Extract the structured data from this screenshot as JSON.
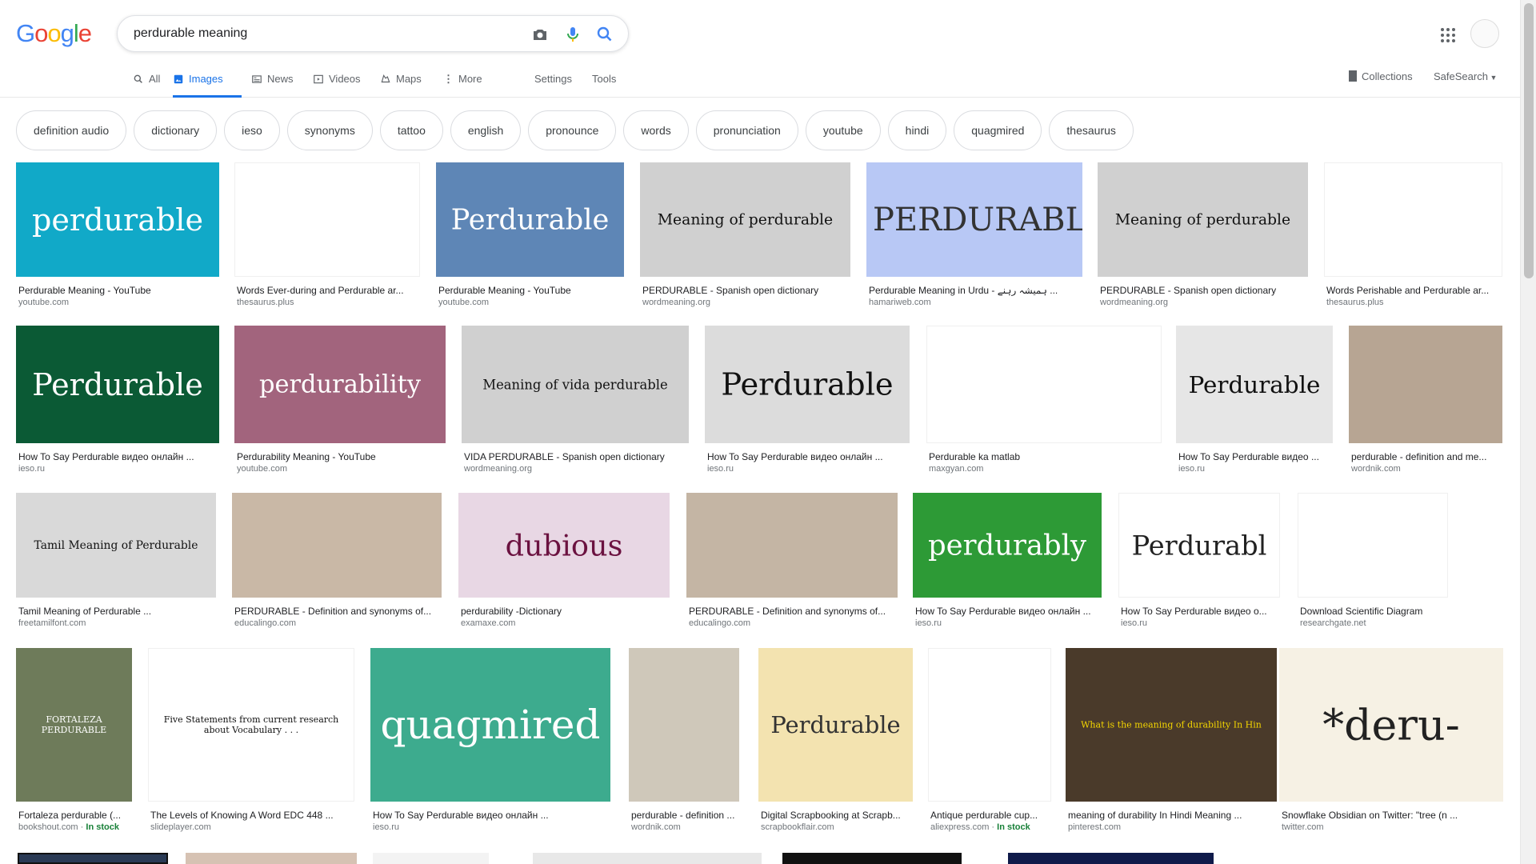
{
  "logo": {
    "letters": [
      "G",
      "o",
      "o",
      "g",
      "l",
      "e"
    ],
    "colors": [
      "#4285f4",
      "#ea4335",
      "#fbbc05",
      "#4285f4",
      "#34a853",
      "#ea4335"
    ]
  },
  "search": {
    "value": "perdurable meaning"
  },
  "tabs": {
    "all": "All",
    "images": "Images",
    "news": "News",
    "videos": "Videos",
    "maps": "Maps",
    "more": "More",
    "settings": "Settings",
    "tools": "Tools"
  },
  "right_nav": {
    "collections": "Collections",
    "safesearch": "SafeSearch"
  },
  "chips": [
    "definition audio",
    "dictionary",
    "ieso",
    "synonyms",
    "tattoo",
    "english",
    "pronounce",
    "words",
    "pronunciation",
    "youtube",
    "hindi",
    "quagmired",
    "thesaurus"
  ],
  "results": [
    {
      "caption": "Perdurable Meaning - YouTube",
      "source": "youtube.com",
      "img_text": "perdurable",
      "bg": "#11a9c8",
      "fg": "#ffffff"
    },
    {
      "caption": "Words Ever-during and Perdurable ar...",
      "source": "thesaurus.plus",
      "img_text": "",
      "bg": "#ffffff",
      "fg": "#333333"
    },
    {
      "caption": "Perdurable Meaning - YouTube",
      "source": "youtube.com",
      "img_text": "Perdurable",
      "bg": "#5e86b6",
      "fg": "#ffffff"
    },
    {
      "caption": "PERDURABLE - Spanish open dictionary",
      "source": "wordmeaning.org",
      "img_text": "Meaning of perdurable",
      "bg": "#d0d0d0",
      "fg": "#111111"
    },
    {
      "caption": "Perdurable Meaning in Urdu - ہمیشہ رہنے ...",
      "source": "hamariweb.com",
      "img_text": "PERDURABLE",
      "bg": "#b8c8f5",
      "fg": "#333333"
    },
    {
      "caption": "PERDURABLE - Spanish open dictionary",
      "source": "wordmeaning.org",
      "img_text": "Meaning of perdurable",
      "bg": "#d0d0d0",
      "fg": "#111111"
    },
    {
      "caption": "Words Perishable and Perdurable ar...",
      "source": "thesaurus.plus",
      "img_text": "",
      "bg": "#ffffff",
      "fg": "#333333"
    },
    {
      "caption": "How To Say Perdurable видео онлайн ...",
      "source": "ieso.ru",
      "img_text": "Perdurable",
      "bg": "#0b5a35",
      "fg": "#ffffff"
    },
    {
      "caption": "Perdurability Meaning - YouTube",
      "source": "youtube.com",
      "img_text": "perdurability",
      "bg": "#a2647d",
      "fg": "#ffffff"
    },
    {
      "caption": "VIDA PERDURABLE - Spanish open dictionary",
      "source": "wordmeaning.org",
      "img_text": "Meaning of vida perdurable",
      "bg": "#d0d0d0",
      "fg": "#111111"
    },
    {
      "caption": "How To Say Perdurable видео онлайн ...",
      "source": "ieso.ru",
      "img_text": "Perdurable",
      "bg": "#dcdcdc",
      "fg": "#111111"
    },
    {
      "caption": "Perdurable ka matlab",
      "source": "maxgyan.com",
      "img_text": "",
      "bg": "#ffffff",
      "fg": "#333333"
    },
    {
      "caption": "How To Say Perdurable видео ...",
      "source": "ieso.ru",
      "img_text": "Perdurable",
      "bg": "#e6e6e6",
      "fg": "#111111"
    },
    {
      "caption": "perdurable - definition and me...",
      "source": "wordnik.com",
      "img_text": "",
      "bg": "#b7a593",
      "fg": "#333333"
    },
    {
      "caption": "Tamil Meaning of Perdurable ...",
      "source": "freetamilfont.com",
      "img_text": "Tamil Meaning of Perdurable",
      "bg": "#d9d9d9",
      "fg": "#111111"
    },
    {
      "caption": "PERDURABLE - Definition and synonyms of...",
      "source": "educalingo.com",
      "img_text": "",
      "bg": "#c9b8a6",
      "fg": "#333333"
    },
    {
      "caption": "perdurability -Dictionary",
      "source": "examaxe.com",
      "img_text": "dubious",
      "bg": "#e8d7e4",
      "fg": "#6b1240"
    },
    {
      "caption": "PERDURABLE - Definition and synonyms of...",
      "source": "educalingo.com",
      "img_text": "",
      "bg": "#c4b5a4",
      "fg": "#333333"
    },
    {
      "caption": "How To Say Perdurable видео онлайн ...",
      "source": "ieso.ru",
      "img_text": "perdurably",
      "bg": "#2d9a36",
      "fg": "#ffffff"
    },
    {
      "caption": "How To Say Perdurable видео о...",
      "source": "ieso.ru",
      "img_text": "Perdurabl",
      "bg": "#ffffff",
      "fg": "#222222"
    },
    {
      "caption": "Download Scientific Diagram",
      "source": "researchgate.net",
      "img_text": "",
      "bg": "#ffffff",
      "fg": "#333333"
    },
    {
      "caption": "Fortaleza perdurable (...",
      "source": "bookshout.com",
      "stock": "In stock",
      "img_text": "FORTALEZA PERDURABLE",
      "bg": "#6e7b5a",
      "fg": "#ffffff"
    },
    {
      "caption": "The Levels of Knowing A Word EDC 448 ...",
      "source": "slideplayer.com",
      "img_text": "Five Statements from current research about Vocabulary . . .",
      "bg": "#ffffff",
      "fg": "#111111"
    },
    {
      "caption": "How To Say Perdurable видео онлайн ...",
      "source": "ieso.ru",
      "img_text": "quagmired",
      "bg": "#3dab8e",
      "fg": "#ffffff"
    },
    {
      "caption": "perdurable - definition ...",
      "source": "wordnik.com",
      "img_text": "",
      "bg": "#cfc8ba",
      "fg": "#333333"
    },
    {
      "caption": "Digital Scrapbooking at Scrapb...",
      "source": "scrapbookflair.com",
      "img_text": "Perdurable",
      "bg": "#f3e3b0",
      "fg": "#333333"
    },
    {
      "caption": "Antique perdurable cup...",
      "source": "aliexpress.com",
      "stock": "In stock",
      "img_text": "",
      "bg": "#ffffff",
      "fg": "#333333"
    },
    {
      "caption": "meaning of durability In Hindi Meaning ...",
      "source": "pinterest.com",
      "img_text": "What is the meaning of durability In Hin",
      "bg": "#4a3a2a",
      "fg": "#f5d700"
    },
    {
      "caption": "Snowflake Obsidian on Twitter: \"tree (n ...",
      "source": "twitter.com",
      "img_text": "*deru-",
      "bg": "#f6f1e4",
      "fg": "#222222"
    }
  ]
}
